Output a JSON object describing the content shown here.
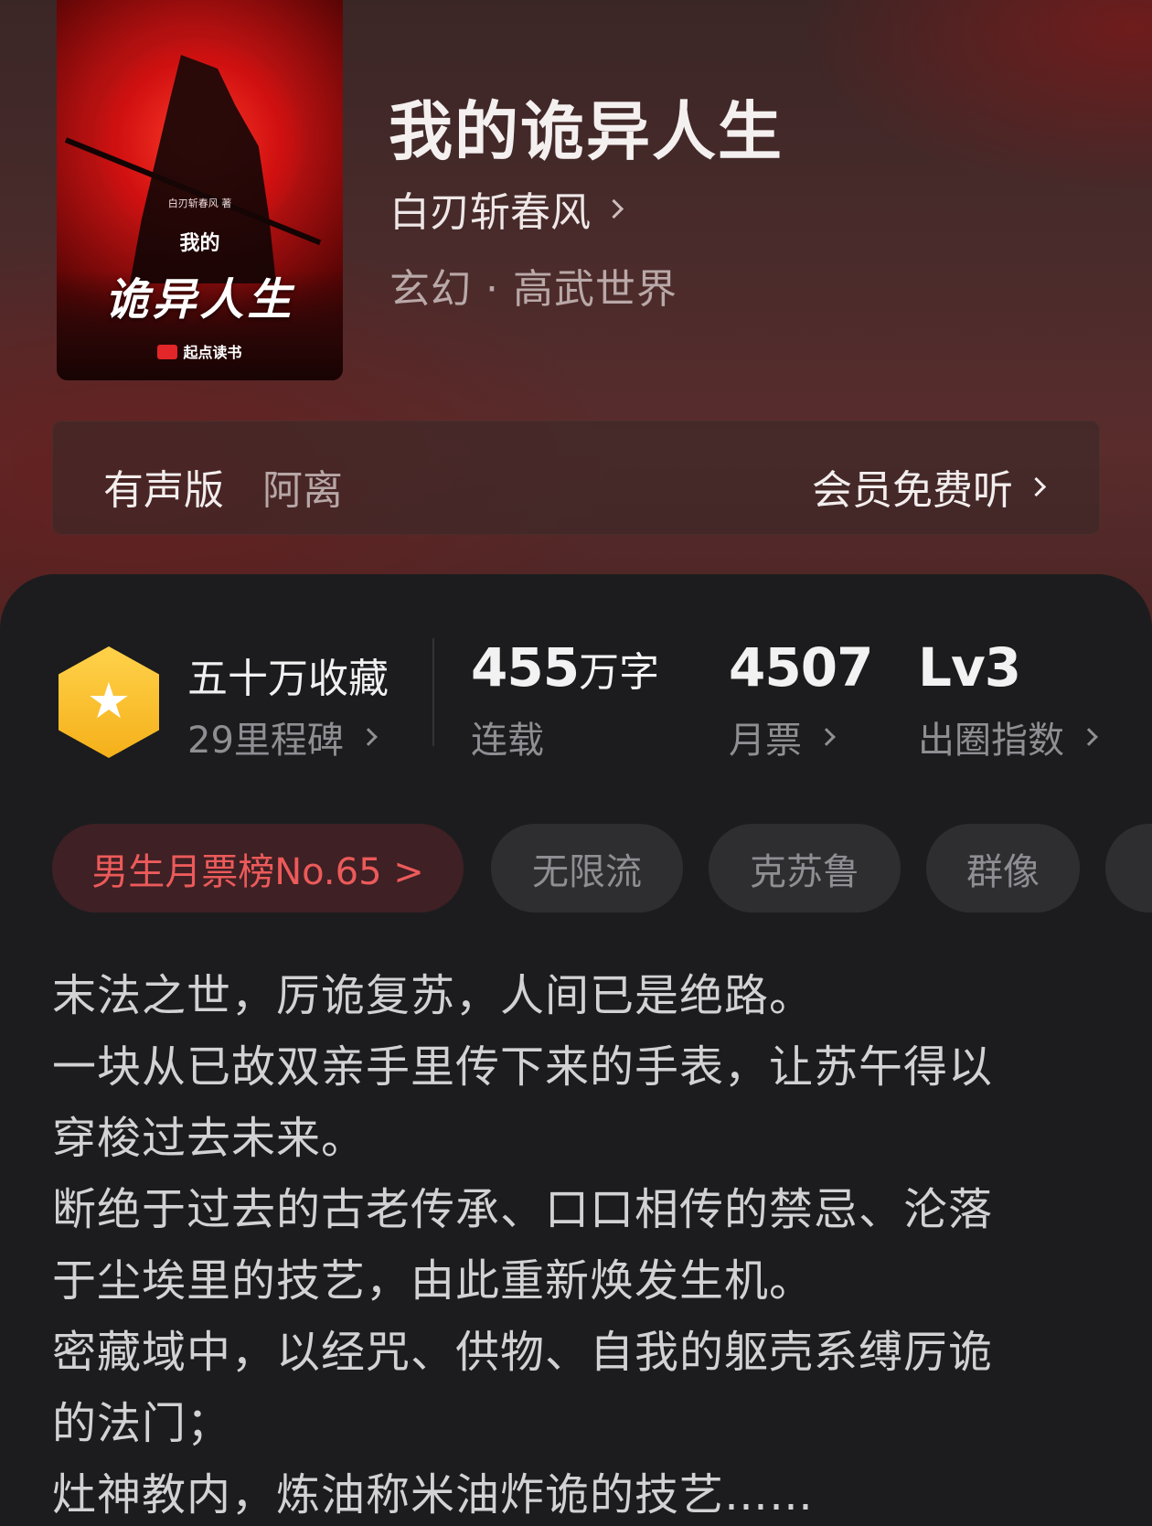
{
  "cover": {
    "author": "白刃斩春风 著",
    "title_small": "我的",
    "title": "诡异人生",
    "brand": "起点读书"
  },
  "book": {
    "title": "我的诡异人生",
    "author": "白刃斩春风",
    "genre": "玄幻 · 高武世界"
  },
  "audio": {
    "label": "有声版",
    "narrator": "阿离",
    "action": "会员免费听"
  },
  "stats": {
    "collection": {
      "title": "五十万收藏",
      "sub": "29里程碑",
      "icon": "star-hexagon-icon"
    },
    "words": {
      "number": "455",
      "unit": "万字",
      "sub": "连载"
    },
    "monthly_votes": {
      "number": "4507",
      "sub": "月票"
    },
    "influence": {
      "number": "Lv3",
      "sub": "出圈指数"
    }
  },
  "tags": {
    "rank": "男生月票榜No.65 >",
    "items": [
      "无限流",
      "克苏鲁",
      "群像"
    ]
  },
  "synopsis": {
    "lines": [
      "末法之世，厉诡复苏，人间已是绝路。",
      "一块从已故双亲手里传下来的手表，让苏午得以",
      "穿梭过去未来。",
      "断绝于过去的古老传承、口口相传的禁忌、沦落",
      "于尘埃里的技艺，由此重新焕发生机。",
      "密藏域中，以经咒、供物、自我的躯壳系缚厉诡",
      "的法门；",
      "灶神教内，炼油称米油炸诡的技艺……"
    ]
  },
  "colors": {
    "accent_red": "#ec5a5a",
    "badge_gold": "#f5b01a",
    "sheet_bg": "#1c1c1e"
  }
}
